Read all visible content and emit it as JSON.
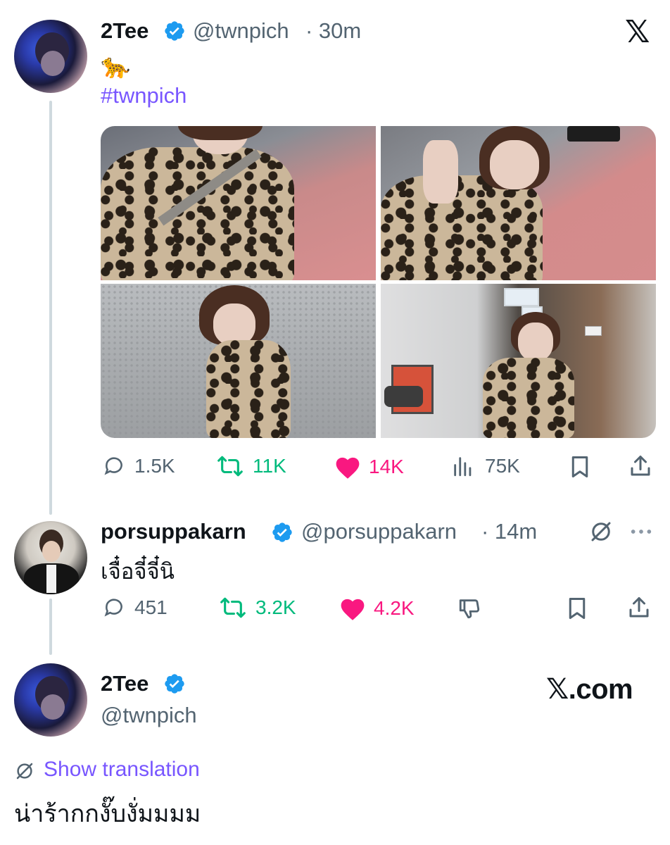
{
  "tweet1": {
    "name": "2Tee",
    "handle": "@twnpich",
    "time": "· 30m",
    "emoji": "🐆",
    "hashtag": "#twnpich",
    "stats": {
      "replies": "1.5K",
      "reposts": "11K",
      "likes": "14K",
      "views": "75K"
    }
  },
  "tweet2": {
    "name": "porsuppakarn",
    "handle": "@porsuppakarn",
    "time": "· 14m",
    "text": "เจื๋อจี๋จี๋นิ",
    "stats": {
      "replies": "451",
      "reposts": "3.2K",
      "likes": "4.2K"
    }
  },
  "tweet3": {
    "name": "2Tee",
    "handle": "@twnpich",
    "site": "𝕏.com",
    "show_translation": "Show translation",
    "text": "น่าร้ากกงั๊บงั่มมมม"
  },
  "icons": {
    "x_logo": "𝕏",
    "reply": "reply-icon",
    "repost": "repost-icon",
    "like": "heart-icon",
    "views": "views-icon",
    "bookmark": "bookmark-icon",
    "share": "share-icon",
    "dislike": "dislike-icon",
    "more": "more-icon",
    "grok": "grok-icon"
  },
  "colors": {
    "text": "#0f1419",
    "secondary": "#536471",
    "verified": "#1d9bf0",
    "repost": "#00ba7c",
    "like": "#f91880",
    "link": "#7856ff"
  }
}
